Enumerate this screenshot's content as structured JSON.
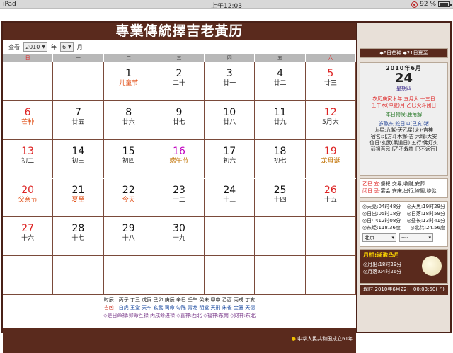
{
  "status": {
    "device": "iPad",
    "time": "上午12:03",
    "battery": "92 %",
    "battery_level": 0.92
  },
  "title": "專業傳統擇吉老黃历",
  "toolbar": {
    "view_label": "查看",
    "year_value": "2010",
    "year_label": "年",
    "month_value": "6",
    "month_label": "月"
  },
  "weekdays": [
    "日",
    "一",
    "二",
    "三",
    "四",
    "五",
    "六"
  ],
  "weeks": [
    [
      {
        "day": "",
        "lunar": ""
      },
      {
        "day": "",
        "lunar": ""
      },
      {
        "day": "1",
        "lunar": "儿童节",
        "lunar_color": "festival"
      },
      {
        "day": "2",
        "lunar": "二十"
      },
      {
        "day": "3",
        "lunar": "廿一"
      },
      {
        "day": "4",
        "lunar": "廿二"
      },
      {
        "day": "5",
        "lunar": "廿三",
        "day_color": "red"
      }
    ],
    [
      {
        "day": "6",
        "lunar": "芒种",
        "day_color": "red",
        "lunar_color": "festival"
      },
      {
        "day": "7",
        "lunar": "廿五"
      },
      {
        "day": "8",
        "lunar": "廿六"
      },
      {
        "day": "9",
        "lunar": "廿七"
      },
      {
        "day": "10",
        "lunar": "廿八"
      },
      {
        "day": "11",
        "lunar": "廿九"
      },
      {
        "day": "12",
        "lunar": "5月大",
        "day_color": "red"
      }
    ],
    [
      {
        "day": "13",
        "lunar": "初二",
        "day_color": "red"
      },
      {
        "day": "14",
        "lunar": "初三"
      },
      {
        "day": "15",
        "lunar": "初四"
      },
      {
        "day": "16",
        "lunar": "端午节",
        "day_color": "magenta",
        "lunar_color": "yellow-green"
      },
      {
        "day": "17",
        "lunar": "初六"
      },
      {
        "day": "18",
        "lunar": "初七"
      },
      {
        "day": "19",
        "lunar": "龙母诞",
        "day_color": "red",
        "lunar_color": "yellow-green"
      }
    ],
    [
      {
        "day": "20",
        "lunar": "父亲节",
        "day_color": "red",
        "lunar_color": "festival"
      },
      {
        "day": "21",
        "lunar": "夏至",
        "lunar_color": "festival"
      },
      {
        "day": "22",
        "lunar": "今天",
        "lunar_color": "festival"
      },
      {
        "day": "23",
        "lunar": "十二"
      },
      {
        "day": "24",
        "lunar": "十三"
      },
      {
        "day": "25",
        "lunar": "十四"
      },
      {
        "day": "26",
        "lunar": "十五",
        "day_color": "red"
      }
    ],
    [
      {
        "day": "27",
        "lunar": "十六",
        "day_color": "red"
      },
      {
        "day": "28",
        "lunar": "十七"
      },
      {
        "day": "29",
        "lunar": "十八"
      },
      {
        "day": "30",
        "lunar": "十九"
      },
      {
        "day": "",
        "lunar": ""
      },
      {
        "day": "",
        "lunar": ""
      },
      {
        "day": "",
        "lunar": ""
      }
    ],
    [
      {
        "day": "",
        "lunar": ""
      },
      {
        "day": "",
        "lunar": ""
      },
      {
        "day": "",
        "lunar": ""
      },
      {
        "day": "",
        "lunar": ""
      },
      {
        "day": "",
        "lunar": ""
      },
      {
        "day": "",
        "lunar": ""
      },
      {
        "day": "",
        "lunar": ""
      }
    ]
  ],
  "footer": {
    "line1": "时辰：丙子 丁丑 戊寅 己卯 庚辰 辛巳 壬午 癸未 甲申 乙酉 丙戌 丁亥",
    "line2_label": "吉凶：",
    "line2": "白虎 玉堂 天牢 玄武 司命 勾陈 青龙 明堂 天刑 朱雀 金匮 天德",
    "line3": "◇是日命禄:卯命互禄 丙戌命进禄 ◇喜神:西北 ◇福神:东南 ◇财神:东北",
    "note": "中华人民共和国成立61年"
  },
  "side": {
    "terms": "◆6日芒种 ◆21日夏至",
    "year_month": "2010年6月",
    "day": "24",
    "weekday": "星期四",
    "lunar1": "农历庚寅木年 五月大 十三日",
    "lunar2": "壬午木(仲夏)月 乙巳火斗闭日",
    "phenology": "本日物候:鹿角解",
    "clash": "岁煞东 蛇日冲(己亥)猪",
    "star1": "九星:九紫-天乙星(火)-吉神",
    "lodge": "宿名:北方斗木獬-吉 六曜:大安",
    "duty": "值日:玄武(黑道日) 五行:佛灯火",
    "pengzu": "彭祖百忌:[乙不栽植 巳不远行]",
    "yi_label": "乙巳 宜:",
    "yi": "祭祀,交易,收财,安葬",
    "ji_label": "闭日 忌:",
    "ji": "宴会,安床,出行,嫁娶,移徙",
    "sun": [
      {
        "left": "◎天亮:04时48分",
        "right": "◎天黑:19时29分"
      },
      {
        "left": "◎日出:05时18分",
        "right": "◎日落:18时59分"
      },
      {
        "left": "◎日中:12时08分",
        "right": "◎昼长:13时41分"
      },
      {
        "left": "◎东经:118.36度",
        "right": "◎北纬:24.56度"
      }
    ],
    "city_value": "北京",
    "other_value": "----",
    "moon_title": "月相:渐盈凸月",
    "moonrise": "◎月出:18时29分",
    "moonset": "◎月落:04时26分",
    "now": "现时:2010年6月22日 00:03:50(子)"
  }
}
